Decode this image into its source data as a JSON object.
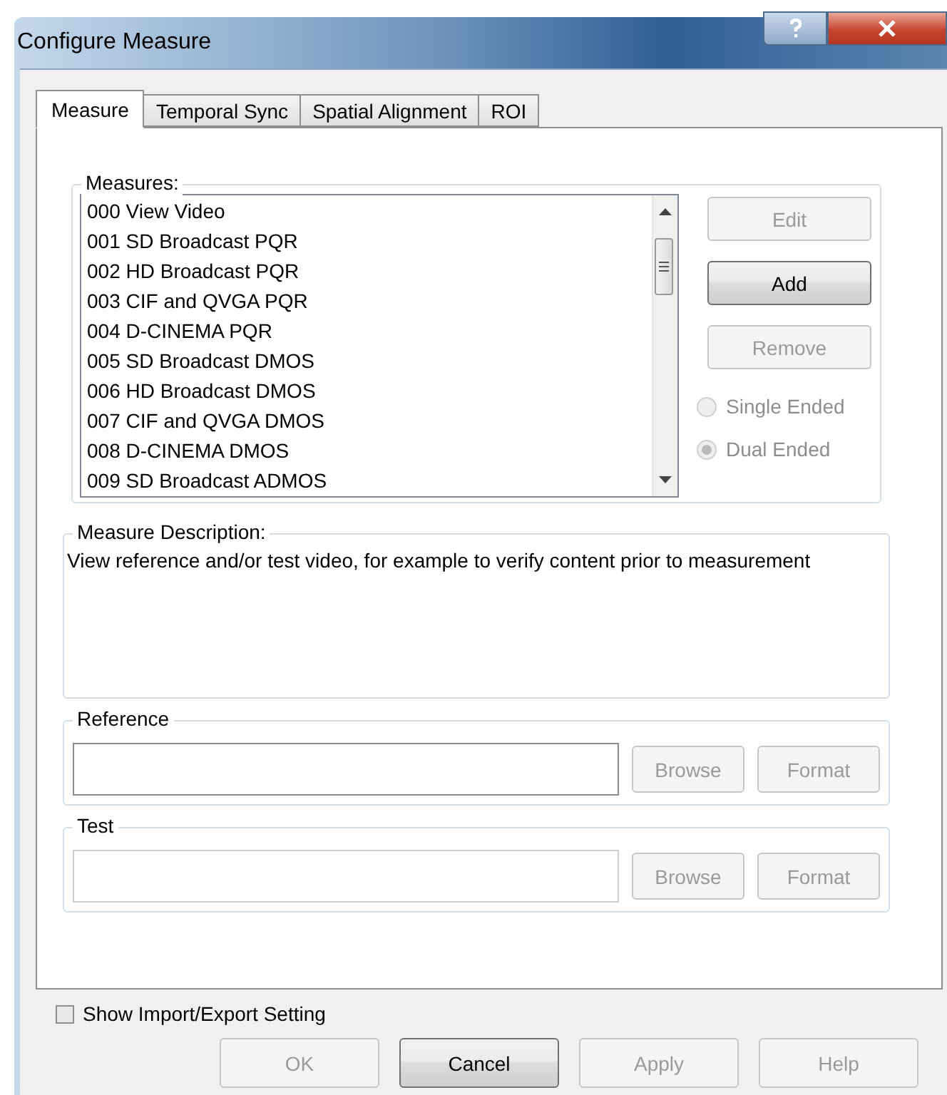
{
  "window": {
    "title": "Configure Measure"
  },
  "tabs": [
    {
      "label": "Measure",
      "selected": true
    },
    {
      "label": "Temporal Sync",
      "selected": false
    },
    {
      "label": "Spatial Alignment",
      "selected": false
    },
    {
      "label": "ROI",
      "selected": false
    }
  ],
  "measures": {
    "label": "Measures:",
    "items": [
      "000 View Video",
      "001 SD Broadcast PQR",
      "002 HD Broadcast PQR",
      "003 CIF and QVGA PQR",
      "004 D-CINEMA PQR",
      "005 SD Broadcast DMOS",
      "006 HD Broadcast DMOS",
      "007 CIF and QVGA DMOS",
      "008 D-CINEMA DMOS",
      "009 SD Broadcast ADMOS"
    ]
  },
  "measure_buttons": [
    {
      "label": "Edit",
      "disabled": true
    },
    {
      "label": "Add",
      "disabled": false
    },
    {
      "label": "Remove",
      "disabled": true
    }
  ],
  "modes": [
    {
      "label": "Single Ended",
      "selected": false,
      "disabled": true
    },
    {
      "label": "Dual Ended",
      "selected": true,
      "disabled": true
    }
  ],
  "description": {
    "label": "Measure Description:",
    "text": "View reference and/or test video, for example to verify content prior to measurement"
  },
  "reference": {
    "label": "Reference",
    "disabled": false,
    "buttons": [
      {
        "label": "Browse",
        "disabled": true
      },
      {
        "label": "Format",
        "disabled": true
      }
    ]
  },
  "test": {
    "label": "Test",
    "disabled": true,
    "buttons": [
      {
        "label": "Browse",
        "disabled": true
      },
      {
        "label": "Format",
        "disabled": true
      }
    ]
  },
  "show_import_export": {
    "label": "Show Import/Export Setting",
    "checked": false
  },
  "dialog_buttons": [
    {
      "label": "OK",
      "disabled": true
    },
    {
      "label": "Cancel",
      "disabled": false
    },
    {
      "label": "Apply",
      "disabled": true
    },
    {
      "label": "Help",
      "disabled": true
    }
  ]
}
